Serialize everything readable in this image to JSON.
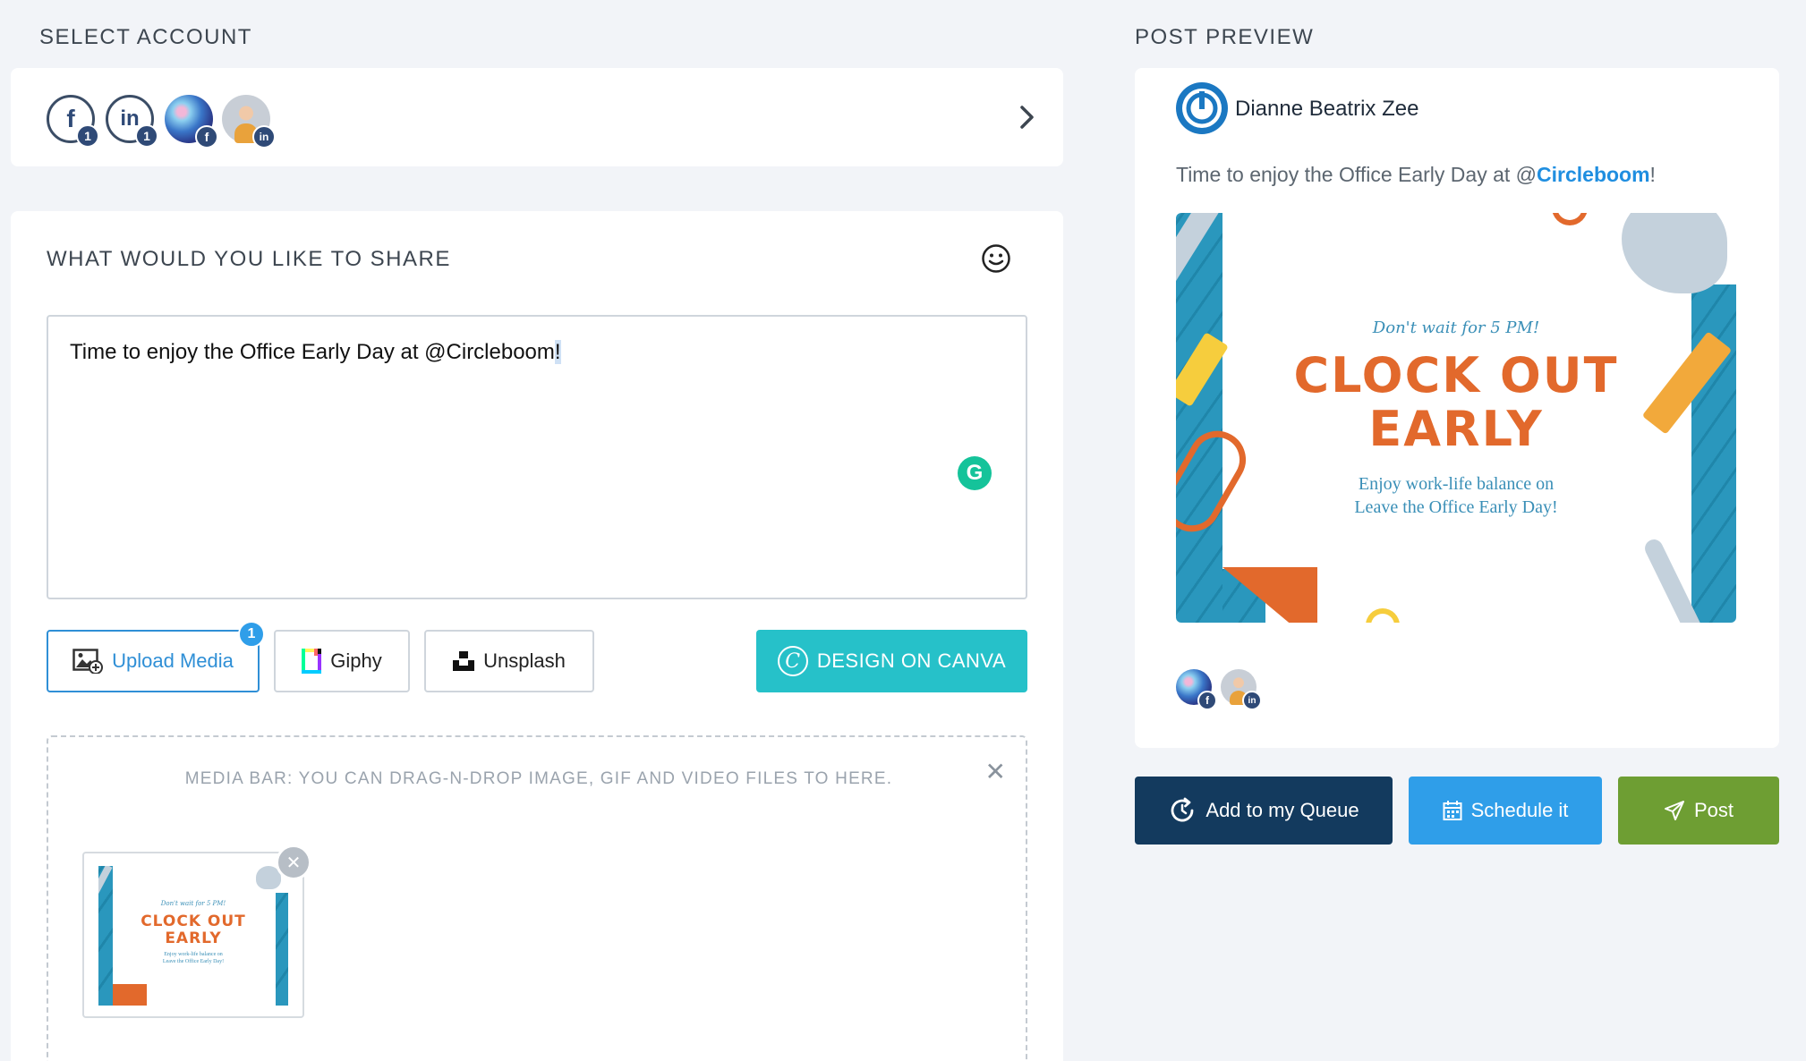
{
  "select_account": {
    "title": "SELECT ACCOUNT",
    "accounts": [
      {
        "name": "facebook-account",
        "glyph": "f",
        "badge": "1"
      },
      {
        "name": "linkedin-account",
        "glyph": "in",
        "badge": "1"
      },
      {
        "name": "page-avatar",
        "badge_glyph": "f"
      },
      {
        "name": "person-avatar",
        "badge_glyph": "in"
      }
    ]
  },
  "composer": {
    "title": "WHAT WOULD YOU LIKE TO SHARE",
    "text_before": "Time to enjoy the Office Early Day at @Circleboom",
    "text_cursor": "!",
    "grammarly": "G"
  },
  "media_buttons": {
    "upload": "Upload Media",
    "upload_badge": "1",
    "giphy": "Giphy",
    "unsplash": "Unsplash",
    "canva": "DESIGN ON CANVA"
  },
  "media_bar": {
    "hint": "MEDIA BAR: YOU CAN DRAG-N-DROP IMAGE, GIF AND VIDEO FILES TO HERE.",
    "close": "✕"
  },
  "poster": {
    "tagline": "Don't wait for 5 PM!",
    "line1": "CLOCK OUT",
    "line2": "EARLY",
    "sub1": "Enjoy work-life balance on",
    "sub2": "Leave the Office Early Day!"
  },
  "preview": {
    "title": "POST PREVIEW",
    "author": "Dianne Beatrix Zee",
    "text_before": "Time to enjoy the Office Early Day at @",
    "mention": "Circleboom",
    "text_after": "!"
  },
  "actions": {
    "queue": "Add to my Queue",
    "schedule": "Schedule it",
    "post": "Post"
  },
  "colors": {
    "navy": "#133a5e",
    "blue": "#2f9ee9",
    "green": "#6e9e33",
    "teal": "#26c1c9",
    "orange": "#e2692c",
    "poster_blue": "#2a97bd"
  }
}
